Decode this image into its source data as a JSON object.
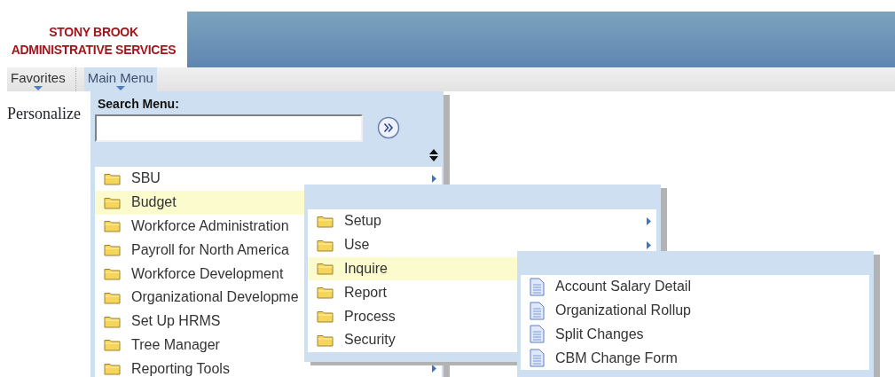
{
  "logo": {
    "lines": [
      "STONY BROOK",
      "ADMINISTRATIVE SERVICES"
    ]
  },
  "nav": [
    {
      "label": "Favorites",
      "selected": false
    },
    {
      "label": "Main Menu",
      "selected": true
    }
  ],
  "page_text": "Personalize",
  "main_menu": {
    "search_label": "Search Menu:",
    "items": [
      {
        "label": "SBU",
        "kind": "folder",
        "has_arrow": true,
        "selected": false
      },
      {
        "label": "Budget",
        "kind": "folder",
        "has_arrow": false,
        "selected": true
      },
      {
        "label": "Workforce Administration",
        "kind": "folder",
        "has_arrow": false,
        "selected": false
      },
      {
        "label": "Payroll for North America",
        "kind": "folder",
        "has_arrow": false,
        "selected": false
      },
      {
        "label": "Workforce Development",
        "kind": "folder",
        "has_arrow": false,
        "selected": false
      },
      {
        "label": "Organizational Developme",
        "kind": "folder",
        "has_arrow": false,
        "selected": false
      },
      {
        "label": "Set Up HRMS",
        "kind": "folder",
        "has_arrow": false,
        "selected": false
      },
      {
        "label": "Tree Manager",
        "kind": "folder",
        "has_arrow": false,
        "selected": false
      },
      {
        "label": "Reporting Tools",
        "kind": "folder",
        "has_arrow": true,
        "selected": false
      }
    ]
  },
  "budget_menu": {
    "items": [
      {
        "label": "Setup",
        "kind": "folder",
        "has_arrow": true,
        "selected": false
      },
      {
        "label": "Use",
        "kind": "folder",
        "has_arrow": true,
        "selected": false
      },
      {
        "label": "Inquire",
        "kind": "folder",
        "has_arrow": false,
        "selected": true
      },
      {
        "label": "Report",
        "kind": "folder",
        "has_arrow": false,
        "selected": false
      },
      {
        "label": "Process",
        "kind": "folder",
        "has_arrow": false,
        "selected": false
      },
      {
        "label": "Security",
        "kind": "folder",
        "has_arrow": false,
        "selected": false
      }
    ]
  },
  "inquire_menu": {
    "items": [
      {
        "label": "Account Salary Detail",
        "kind": "document",
        "has_arrow": false,
        "selected": false
      },
      {
        "label": "Organizational Rollup",
        "kind": "document",
        "has_arrow": false,
        "selected": false
      },
      {
        "label": "Split Changes",
        "kind": "document",
        "has_arrow": false,
        "selected": false
      },
      {
        "label": "CBM Change Form",
        "kind": "document",
        "has_arrow": false,
        "selected": false
      }
    ]
  }
}
